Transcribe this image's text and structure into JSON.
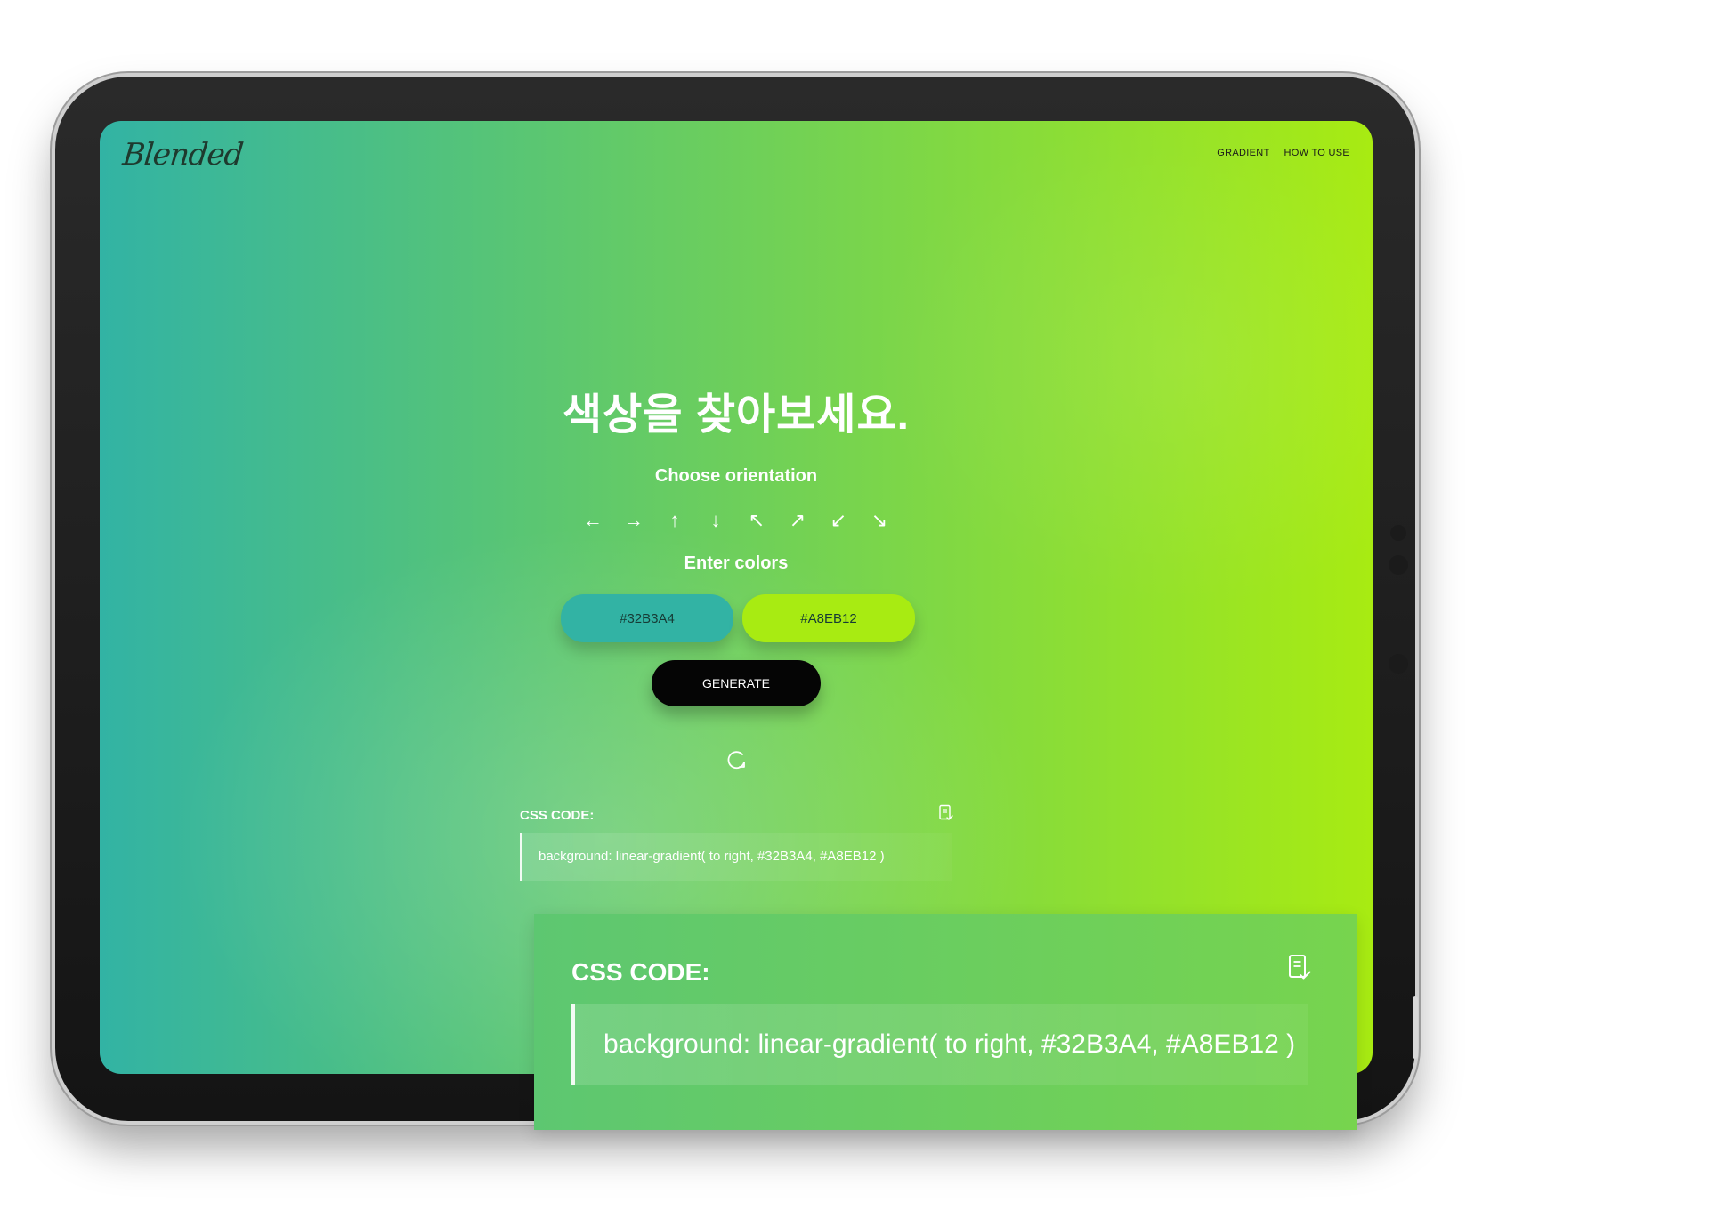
{
  "brand": {
    "logo_text": "Blended"
  },
  "nav": {
    "items": [
      "GRADIENT",
      "HOW TO USE"
    ]
  },
  "hero": {
    "heading": "색상을 찾아보세요."
  },
  "orientation": {
    "label": "Choose orientation",
    "arrows": [
      {
        "icon": "arrow-left-icon",
        "glyph": "←"
      },
      {
        "icon": "arrow-right-icon",
        "glyph": "→"
      },
      {
        "icon": "arrow-up-icon",
        "glyph": "↑"
      },
      {
        "icon": "arrow-down-icon",
        "glyph": "↓"
      },
      {
        "icon": "arrow-up-left-icon",
        "glyph": "↖"
      },
      {
        "icon": "arrow-up-right-icon",
        "glyph": "↗"
      },
      {
        "icon": "arrow-down-left-icon",
        "glyph": "↙"
      },
      {
        "icon": "arrow-down-right-icon",
        "glyph": "↘"
      }
    ]
  },
  "colors": {
    "label": "Enter colors",
    "color1": "#32B3A4",
    "color2": "#A8EB12",
    "generate_label": "GENERATE"
  },
  "css_code": {
    "label": "CSS CODE:",
    "value": "background: linear-gradient( to right, #32B3A4, #A8EB12 )",
    "copy_icon": "copy-clipboard-icon",
    "refresh_icon": "refresh-icon"
  },
  "zoom": {
    "label": "CSS CODE:",
    "value": "background: linear-gradient( to right, #32B3A4, #A8EB12 )"
  }
}
